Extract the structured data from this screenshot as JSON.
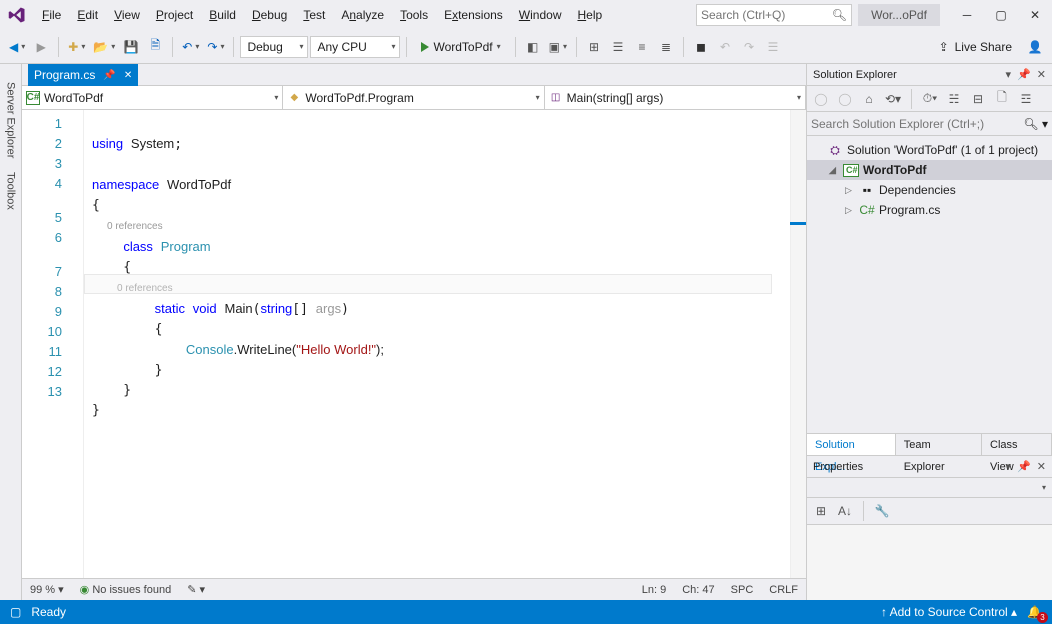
{
  "menu": [
    "File",
    "Edit",
    "View",
    "Project",
    "Build",
    "Debug",
    "Test",
    "Analyze",
    "Tools",
    "Extensions",
    "Window",
    "Help"
  ],
  "search_placeholder": "Search (Ctrl+Q)",
  "title_project": "Wor...oPdf",
  "config_combo": "Debug",
  "platform_combo": "Any CPU",
  "run_target": "WordToPdf",
  "live_share": "Live Share",
  "side_tabs": [
    "Server Explorer",
    "Toolbox"
  ],
  "doc_tab": {
    "name": "Program.cs"
  },
  "nav": {
    "scope": "WordToPdf",
    "class": "WordToPdf.Program",
    "member": "Main(string[] args)"
  },
  "code": {
    "lines": [
      "1",
      "2",
      "3",
      "4",
      "5",
      "6",
      "7",
      "8",
      "9",
      "10",
      "11",
      "12",
      "13"
    ],
    "ref_text": "0 references",
    "l1_kw": "using",
    "l1_ns": "System",
    "l3_kw": "namespace",
    "l3_nm": "WordToPdf",
    "l5_kw": "class",
    "l5_nm": "Program",
    "l7_kw1": "static",
    "l7_kw2": "void",
    "l7_nm": "Main",
    "l7_kw3": "string",
    "l7_arg": "args",
    "l9_cls": "Console",
    "l9_m": ".WriteLine(",
    "l9_str": "\"Hello World!\"",
    "l9_end": ");"
  },
  "editor_status": {
    "zoom": "99 %",
    "issues": "No issues found",
    "ln": "Ln: 9",
    "ch": "Ch: 47",
    "spc": "SPC",
    "crlf": "CRLF"
  },
  "solution_explorer": {
    "title": "Solution Explorer",
    "search_placeholder": "Search Solution Explorer (Ctrl+;)",
    "root": "Solution 'WordToPdf' (1 of 1 project)",
    "project": "WordToPdf",
    "deps": "Dependencies",
    "file": "Program.cs",
    "tabs": [
      "Solution Expl...",
      "Team Explorer",
      "Class View"
    ]
  },
  "properties": {
    "title": "Properties"
  },
  "statusbar": {
    "ready": "Ready",
    "scc": "Add to Source Control",
    "notif": "3"
  }
}
